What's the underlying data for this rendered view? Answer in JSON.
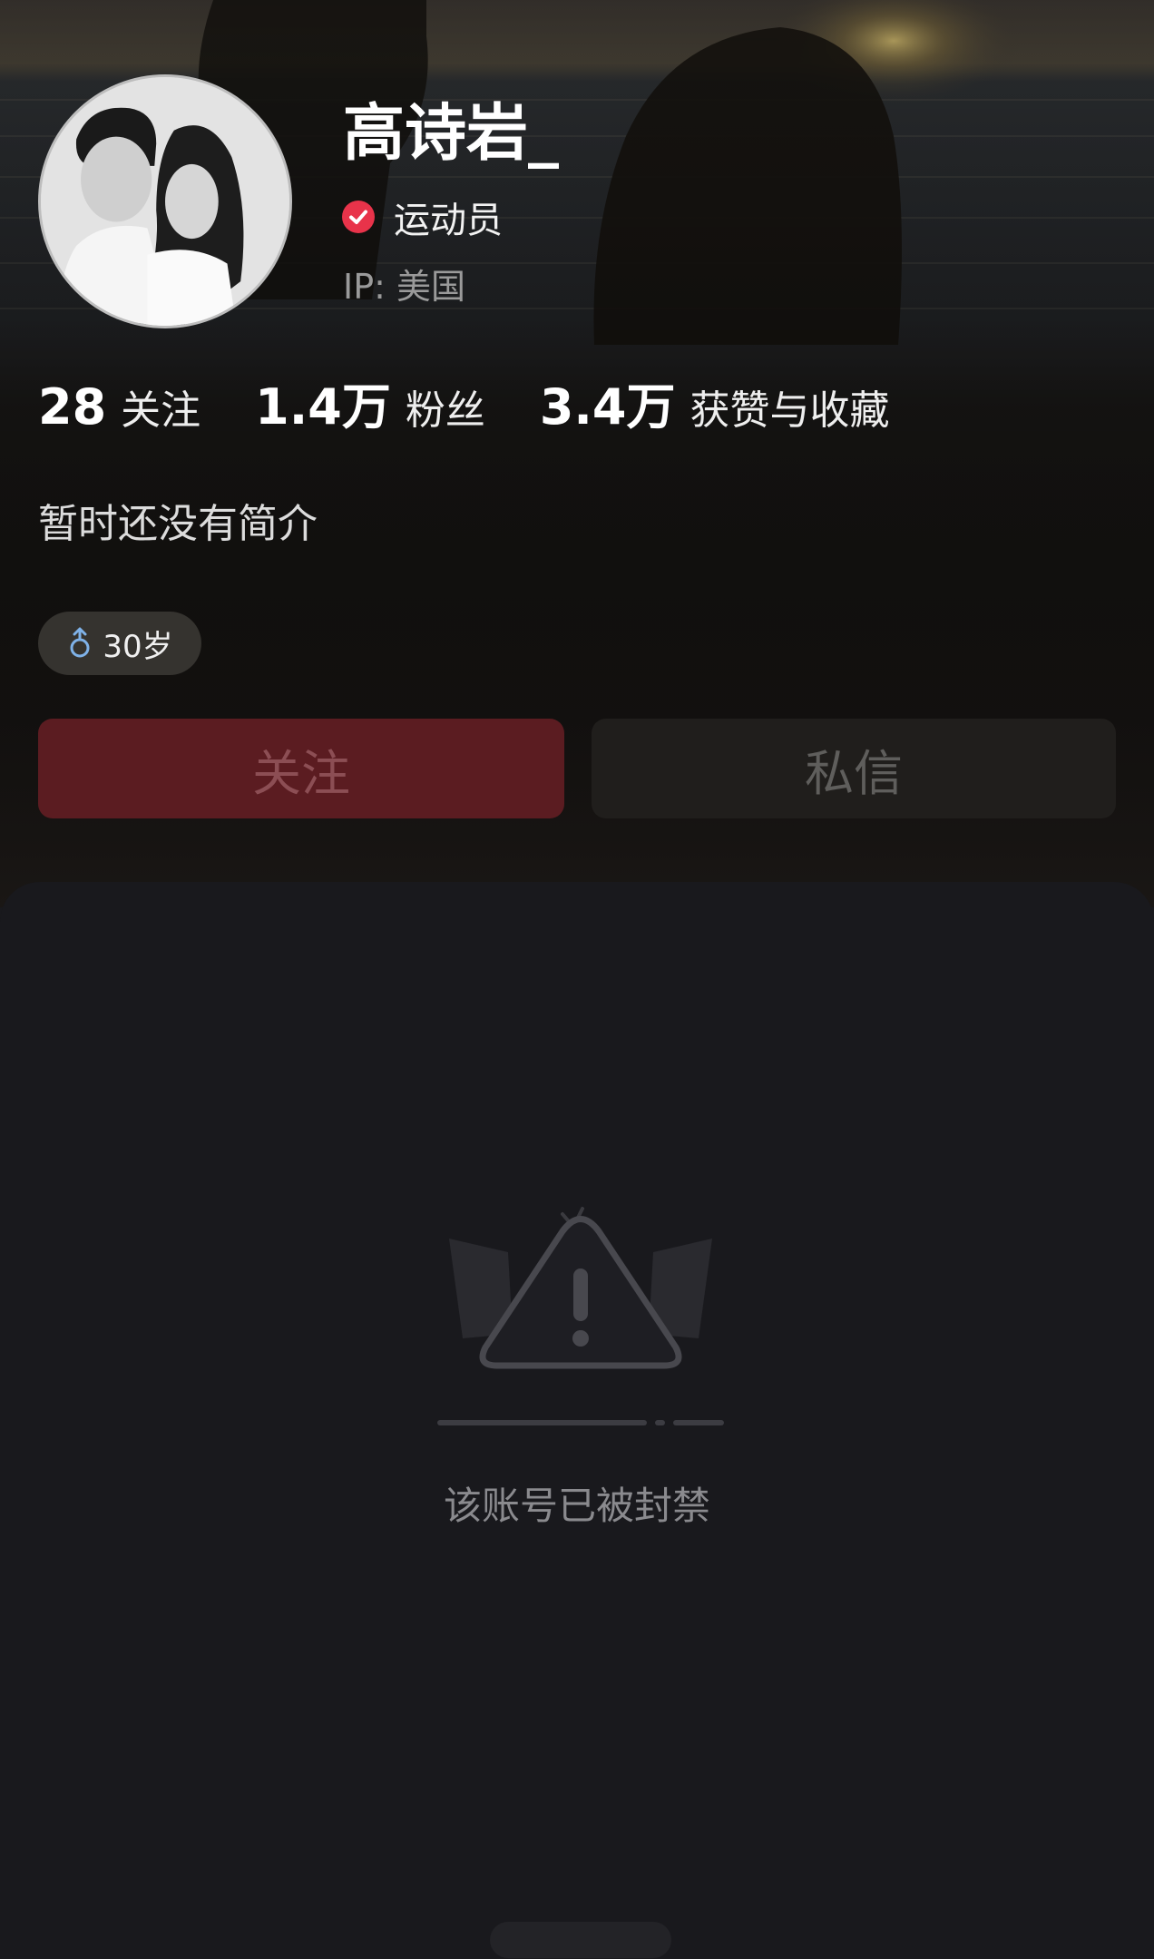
{
  "profile": {
    "name": "高诗岩_",
    "verified_label": "运动员",
    "ip": "IP: 美国",
    "bio": "暂时还没有简介",
    "age_tag": "30岁",
    "gender_icon": "male-icon",
    "verified_icon": "verified-check-icon"
  },
  "stats": [
    {
      "value": "28",
      "label": "关注"
    },
    {
      "value": "1.4万",
      "label": "粉丝"
    },
    {
      "value": "3.4万",
      "label": "获赞与收藏"
    }
  ],
  "actions": {
    "follow_label": "关注",
    "message_label": "私信"
  },
  "content": {
    "banned_message": "该账号已被封禁",
    "illustration_icon": "warning-triangle-icon"
  },
  "colors": {
    "follow_button_bg": "#5b1c21",
    "verified_red": "#e8334a",
    "page_background": "#19191d"
  }
}
